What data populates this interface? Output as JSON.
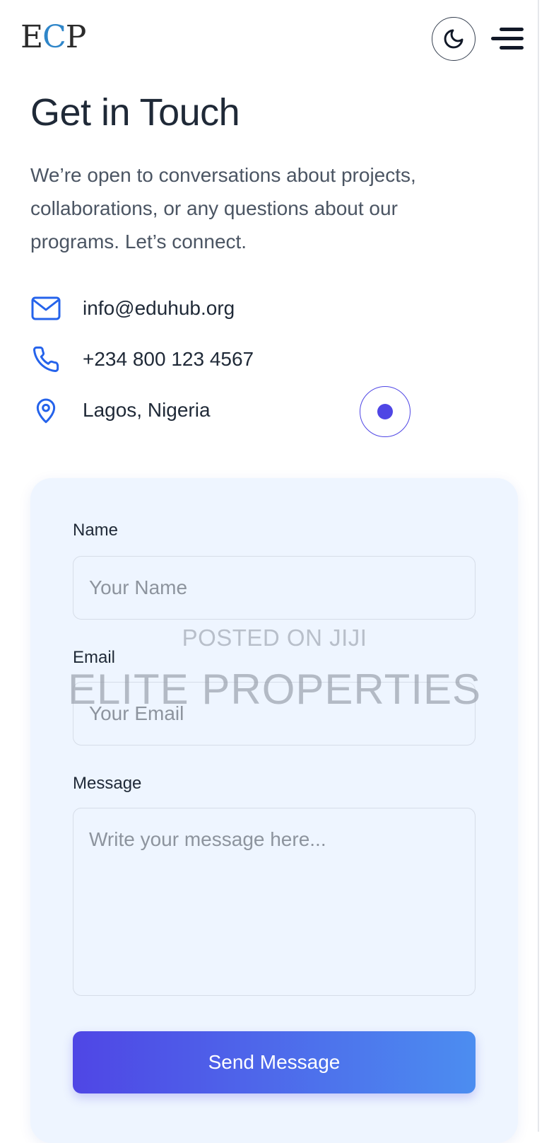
{
  "header": {
    "logo": {
      "part1": "E",
      "part2": "C",
      "part3": "P"
    },
    "theme_toggle_icon": "moon-icon",
    "menu_icon": "hamburger-menu-icon"
  },
  "main": {
    "title": "Get in Touch",
    "intro": "We’re open to conversations about projects, collaborations, or any questions about our programs. Let’s connect.",
    "contacts": [
      {
        "icon": "mail-icon",
        "text": "info@eduhub.org"
      },
      {
        "icon": "phone-icon",
        "text": "+234 800 123 4567"
      },
      {
        "icon": "location-pin-icon",
        "text": "Lagos, Nigeria"
      }
    ]
  },
  "form": {
    "name_label": "Name",
    "name_placeholder": "Your Name",
    "email_label": "Email",
    "email_placeholder": "Your Email",
    "message_label": "Message",
    "message_placeholder": "Write your message here...",
    "submit_label": "Send Message"
  },
  "watermark": {
    "line1": "POSTED ON JIJI",
    "line2": "ELITE PROPERTIES"
  },
  "colors": {
    "accent": "#4f46e5",
    "icon_blue": "#2563eb",
    "card_background": "#eef5ff",
    "button_gradient_end": "#4c8df0"
  }
}
